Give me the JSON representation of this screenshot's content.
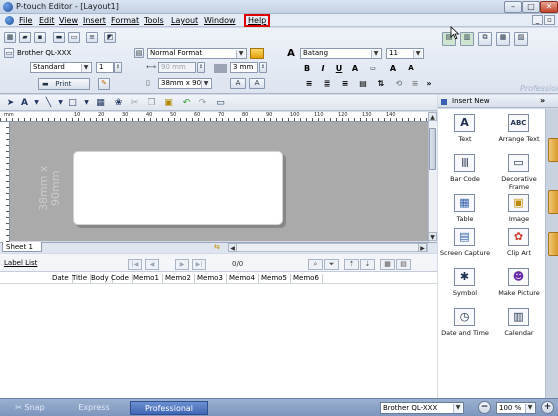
{
  "window": {
    "title": "P-touch Editor - [Layout1]",
    "minimize": "–",
    "maximize": "□",
    "close": "✕"
  },
  "menu": {
    "items": [
      "File",
      "Edit",
      "View",
      "Insert",
      "Format",
      "Tools",
      "Layout",
      "Window",
      "Help"
    ],
    "mdi_minimize": "_",
    "mdi_restore": "▫"
  },
  "toolbar": {
    "printer": "Brother QL-XXX",
    "mode": "Standard",
    "copies": "1",
    "print_label": "Print",
    "format": "Normal Format",
    "length": "90 mm",
    "margin": "3 mm",
    "media": "38mm x 90m",
    "font": "Batang",
    "font_size": "11",
    "bold": "B",
    "italic": "I",
    "underline": "U",
    "shadow": "A",
    "grow": "A",
    "shrink": "A",
    "grow_shrink_right": "»"
  },
  "canvas": {
    "label_dim": "38mm x 90mm",
    "ruler_marks": [
      "10",
      "20",
      "30",
      "40",
      "50",
      "60",
      "70",
      "80",
      "90",
      "100",
      "110",
      "120",
      "130",
      "140"
    ],
    "sheet_tab": "Sheet 1"
  },
  "label_list": {
    "title": "Label List",
    "count": "0/0",
    "columns": [
      "Date",
      "Title",
      "Body",
      "Code",
      "Memo1",
      "Memo2",
      "Memo3",
      "Memo4",
      "Memo5",
      "Memo6"
    ]
  },
  "insert_panel": {
    "header": "Insert New",
    "chevron": "»",
    "items": [
      {
        "label": "Text",
        "glyph": "A"
      },
      {
        "label": "Arrange Text",
        "glyph": "ABC"
      },
      {
        "label": "Bar Code",
        "glyph": "|||"
      },
      {
        "label": "Decorative Frame",
        "glyph": "▭"
      },
      {
        "label": "Table",
        "glyph": "▦"
      },
      {
        "label": "Image",
        "glyph": "▣"
      },
      {
        "label": "Screen Capture",
        "glyph": "▤"
      },
      {
        "label": "Clip Art",
        "glyph": "✿"
      },
      {
        "label": "Symbol",
        "glyph": "✱"
      },
      {
        "label": "Make Picture",
        "glyph": "☻"
      },
      {
        "label": "Date and Time",
        "glyph": "◷"
      },
      {
        "label": "Calendar",
        "glyph": "▥"
      }
    ],
    "professional_watermark": "Professional"
  },
  "statusbar": {
    "modes": [
      "Snap",
      "Express",
      "Professional"
    ],
    "printer": "Brother QL-XXX",
    "zoom": "100 %",
    "zoom_out": "−",
    "zoom_in": "+"
  },
  "colors": {
    "highlight_box": "#e00000",
    "status_bar": "#7d96bd",
    "canvas_bg": "#a9aaa9"
  }
}
